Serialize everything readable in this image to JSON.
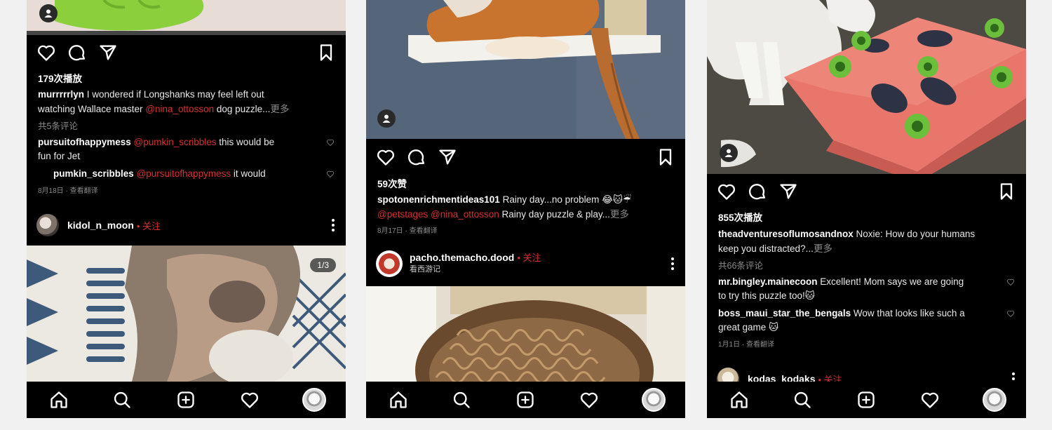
{
  "posts": [
    {
      "likes": "179次播放",
      "caption_user": "murrrrrlyn",
      "caption_text": " I wondered if Longshanks may feel left out",
      "caption_line2_pre": "watching Wallace master ",
      "caption_mention": "@nina_ottosson",
      "caption_line2_post": " dog puzzle...",
      "more": "更多",
      "view_comments": "共5条评论",
      "comments": [
        {
          "user": "pursuitofhappymess",
          "mention": "@pumkin_scribbles",
          "text": " this would be",
          "text2": "fun for Jet"
        },
        {
          "user": "pumkin_scribbles",
          "mention": "@pursuitofhappymess",
          "text": " it would"
        }
      ],
      "timestamp": "8月18日 · 查看翻译",
      "author": "kidol_n_moon",
      "follow": "• 关注"
    },
    {
      "likes": "59次赞",
      "caption_user": "spotonenrichmentideas101",
      "caption_text": " Rainy day...no problem 😂🐱☔",
      "caption_line2_pre": "",
      "caption_mention": "@petstages @nina_ottosson",
      "caption_line2_post": " Rainy day puzzle & play...",
      "more": "更多",
      "timestamp": "8月17日 · 查看翻译",
      "author": "pacho.themacho.dood",
      "follow": "• 关注",
      "author_sub": "看西游记"
    },
    {
      "likes": "855次播放",
      "caption_user": "theadventuresoflumosandnox",
      "caption_text": " Noxie: How do your humans",
      "caption_line2_pre": "keep you distracted?...",
      "more": "更多",
      "view_comments": "共66条评论",
      "comments": [
        {
          "user": "mr.bingley.mainecoon",
          "text": " Excellent! Mom says we are going",
          "text2": "to try this puzzle too!🐱"
        },
        {
          "user": "boss_maui_star_the_bengals",
          "text": " Wow that looks like such a",
          "text2": "great game 🐱"
        }
      ],
      "timestamp": "1月1日 · 查看翻译",
      "author": "kodas_kodaks",
      "follow": "• 关注"
    }
  ],
  "carousel_counter": "1/3",
  "colors": {
    "mention": "#d43030",
    "phone_bg": "#000000",
    "page_bg": "#f1f1f1"
  },
  "icons": [
    "heart-icon",
    "comment-icon",
    "share-icon",
    "bookmark-icon",
    "home-icon",
    "search-icon",
    "add-icon",
    "activity-icon",
    "profile-avatar",
    "user-tag-icon"
  ]
}
